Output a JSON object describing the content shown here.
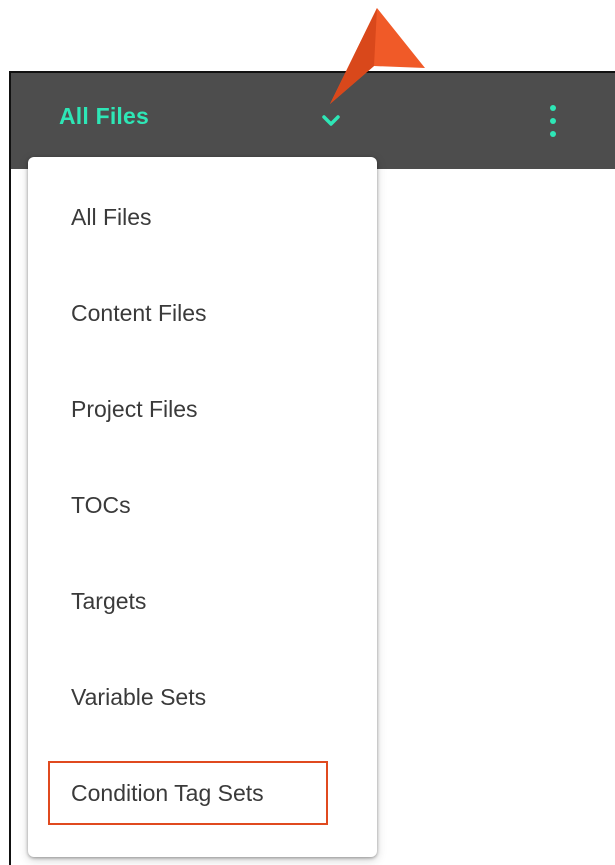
{
  "header": {
    "title": "All Files",
    "accent_color": "#2ee6b6",
    "background_color": "#4d4d4d"
  },
  "dropdown_icon": "chevron-down-icon",
  "menu_icon": "kebab-menu-icon",
  "menu": {
    "items": [
      {
        "label": "All Files"
      },
      {
        "label": "Content Files"
      },
      {
        "label": "Project Files"
      },
      {
        "label": "TOCs"
      },
      {
        "label": "Targets"
      },
      {
        "label": "Variable Sets"
      },
      {
        "label": "Condition Tag Sets"
      }
    ],
    "highlighted_item": "Condition Tag Sets",
    "highlight_color": "#e04a1f"
  },
  "callout": {
    "icon": "pointer-arrow-icon",
    "color": "#f05a28"
  }
}
